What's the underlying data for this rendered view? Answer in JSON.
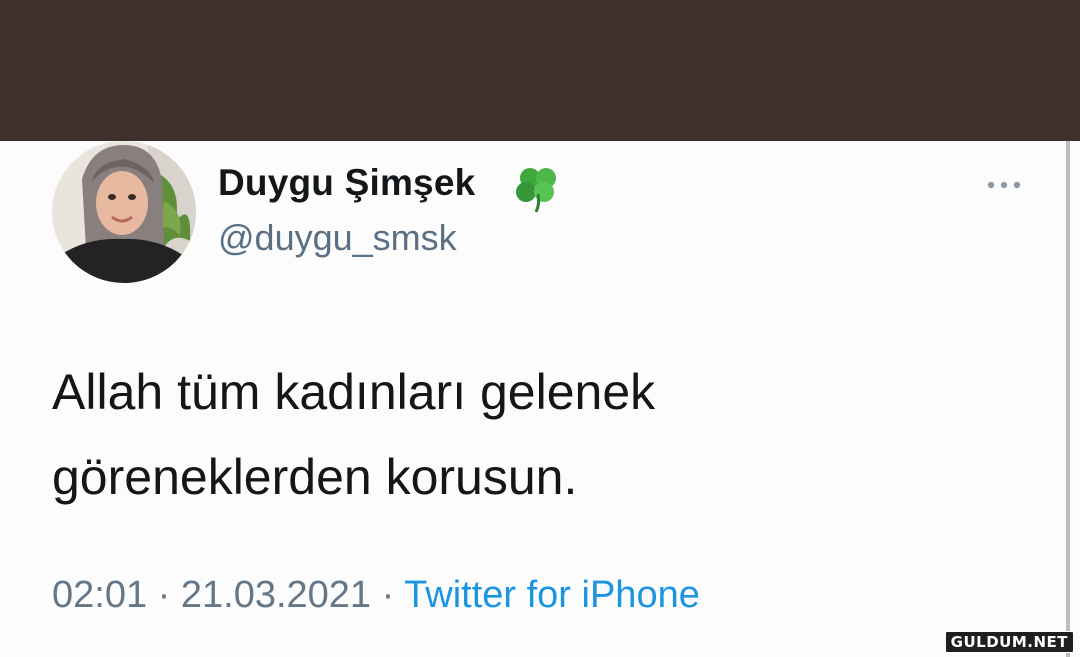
{
  "colors": {
    "top_bar": "#3d302d",
    "background": "#fcfcfc",
    "name": "#14171a",
    "handle": "#5b7083",
    "meta": "#657786",
    "link": "#1b95e0"
  },
  "tweet": {
    "author": {
      "display_name": "Duygu Şimşek",
      "name_emoji": "clover-icon",
      "handle": "@duygu_smsk",
      "avatar": "avatar"
    },
    "more_icon": "more-icon",
    "text_lines": [
      "Allah tüm kadınları gelenek",
      "göreneklerden korusun."
    ],
    "time": "02:01",
    "separator_1": " · ",
    "date": "21.03.2021",
    "separator_2": " · ",
    "source": "Twitter for iPhone"
  },
  "watermark": "GULDUM.NET"
}
